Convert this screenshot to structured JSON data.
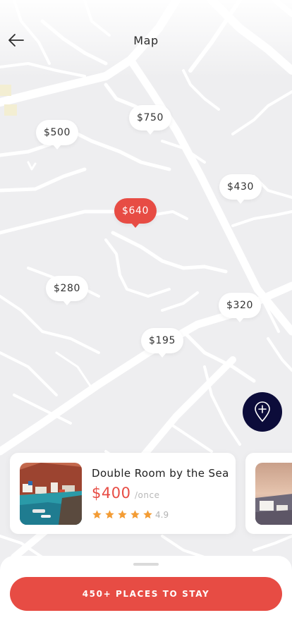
{
  "header": {
    "title": "Map",
    "back_icon": "arrow-left-icon"
  },
  "map": {
    "pins": [
      {
        "label": "$750",
        "active": false
      },
      {
        "label": "$500",
        "active": false
      },
      {
        "label": "$430",
        "active": false
      },
      {
        "label": "$640",
        "active": true
      },
      {
        "label": "$280",
        "active": false
      },
      {
        "label": "$320",
        "active": false
      },
      {
        "label": "$195",
        "active": false
      }
    ],
    "fab_icon": "location-pin-plus-icon"
  },
  "listing_cards": [
    {
      "title": "Double Room by the Sea",
      "price": "$400",
      "price_unit": "/once",
      "rating": "4.9",
      "stars": 5
    }
  ],
  "bottom_sheet": {
    "cta_label": "450+ PLACES TO STAY"
  },
  "colors": {
    "accent": "#e74c44",
    "fab": "#0c0c3a",
    "map_bg": "#eeeef0",
    "star": "#f39c34"
  }
}
